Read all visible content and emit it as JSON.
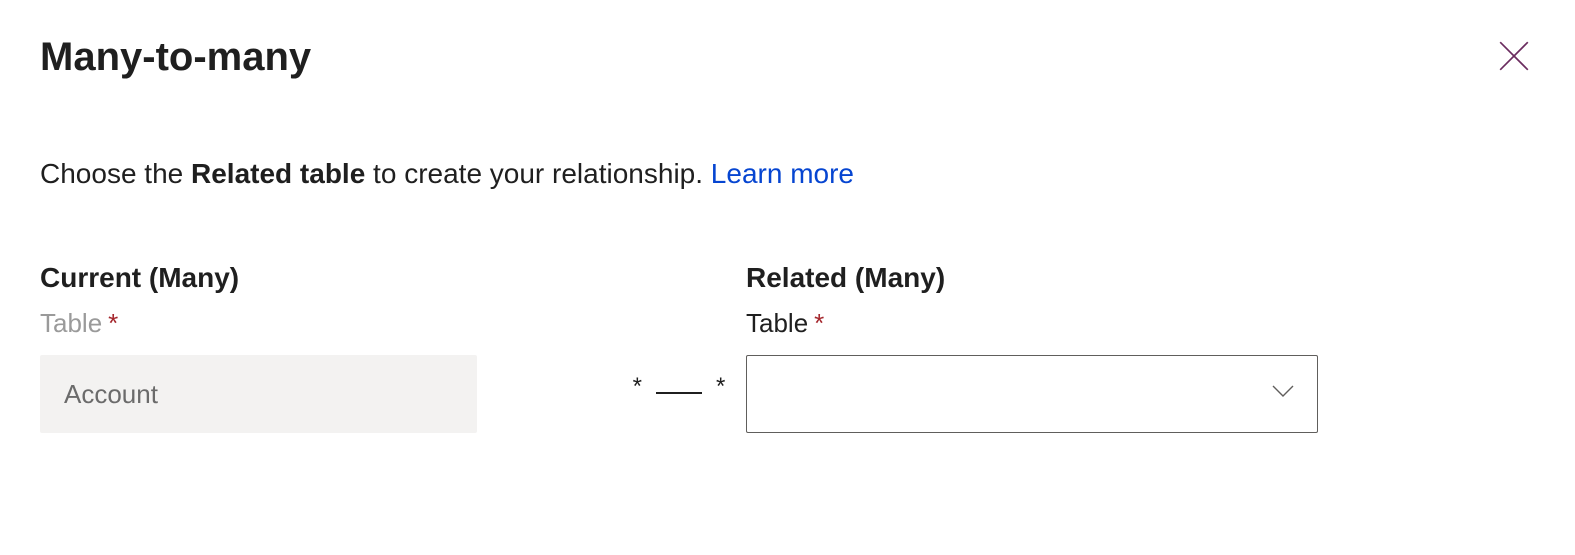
{
  "header": {
    "title": "Many-to-many"
  },
  "description": {
    "prefix": "Choose the ",
    "bold": "Related table",
    "suffix": " to create your relationship. ",
    "learn_more": "Learn more"
  },
  "current": {
    "heading": "Current (Many)",
    "label": "Table",
    "required_mark": "*",
    "value": "Account"
  },
  "connector": {
    "left_star": "*",
    "right_star": "*"
  },
  "related": {
    "heading": "Related (Many)",
    "label": "Table",
    "required_mark": "*",
    "value": ""
  }
}
